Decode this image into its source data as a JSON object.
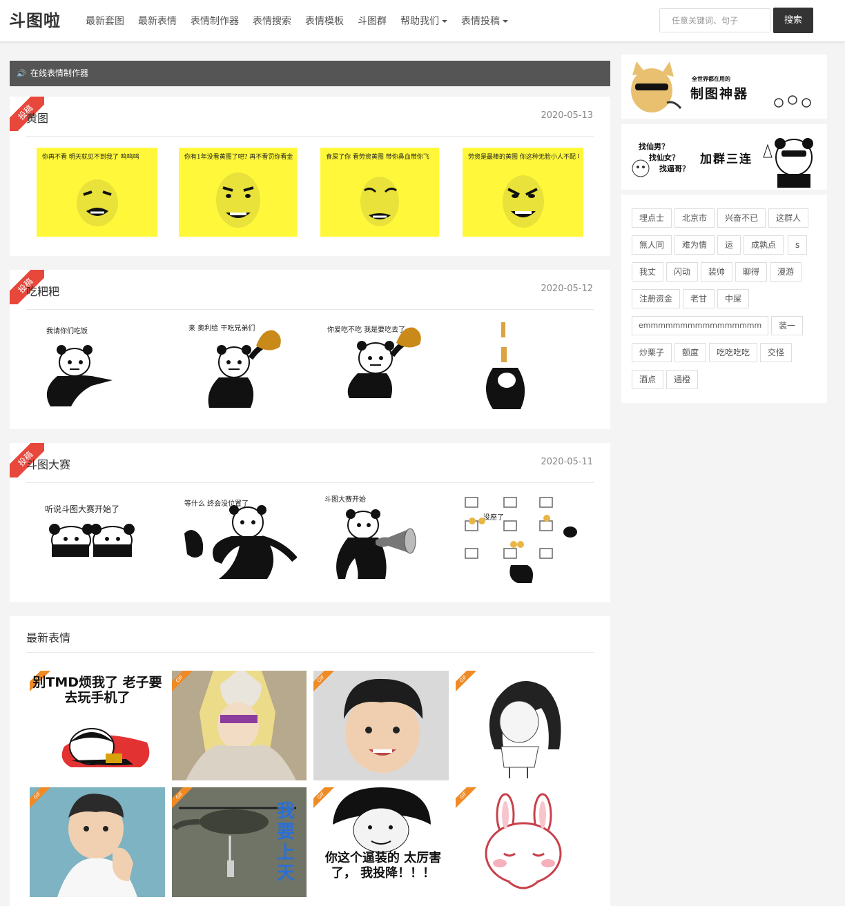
{
  "nav": {
    "logo": "斗图啦",
    "items": [
      "最新套图",
      "最新表情",
      "表情制作器",
      "表情搜索",
      "表情模板",
      "斗图群",
      "帮助我们",
      "表情投稿"
    ]
  },
  "search": {
    "placeholder": "任意关键词、句子",
    "button": "搜索"
  },
  "notice": "在线表情制作器",
  "ribbon": "投稿",
  "sets": [
    {
      "title": "黄图",
      "date": "2020-05-13",
      "captions": [
        "你再不看 明天就见不到我了 呜呜呜",
        "你有1年没看黄图了吧? 再不看罚你看金图",
        "食屎了你 看劳资黄图 带你鼻血带你飞",
        "劳资是最棒的黄图 你这种无脸小人不配 啪啪啪"
      ]
    },
    {
      "title": "吃粑粑",
      "date": "2020-05-12",
      "captions": [
        "我请你们吃饭",
        "来 奥利给 干吃兄弟们",
        "你爱吃不吃 我是要吃去了",
        ""
      ]
    },
    {
      "title": "斗图大赛",
      "date": "2020-05-11",
      "captions": [
        "听说斗图大赛开始了",
        "等什么 终会没位置了",
        "斗图大赛开始",
        "没座了"
      ]
    }
  ],
  "latest": {
    "title": "最新表情",
    "badge": "GIF",
    "texts": [
      "别TMD烦我了 老子要去玩手机了",
      "我要上天",
      "你这个逼装的 太厉害了， 我投降！！！"
    ]
  },
  "side": {
    "banner1": "全世界都在用的",
    "banner1b": "制图神器",
    "banner2a": "找仙男？",
    "banner2b": "找仙女？",
    "banner2c": "找逼哥？",
    "banner2d": "加群三连"
  },
  "tags": [
    "埋点士",
    "北京市",
    "兴奋不已",
    "这群人",
    "無人同",
    "难为情",
    "运",
    "成孰点",
    "s",
    "我丈",
    "闪动",
    "装帅",
    "聊得",
    "漫游",
    "注册资金",
    "老甘",
    "中屎",
    "emmmmmmmmmmmmmmmm",
    "装一",
    "炒栗子",
    "额度",
    "吃吃吃吃",
    "交怪",
    "酒点",
    "通橙"
  ],
  "colors": {
    "accent": "#e8473b",
    "dark": "#333333",
    "yellow": "#fff83a",
    "gif": "#f08a24"
  }
}
